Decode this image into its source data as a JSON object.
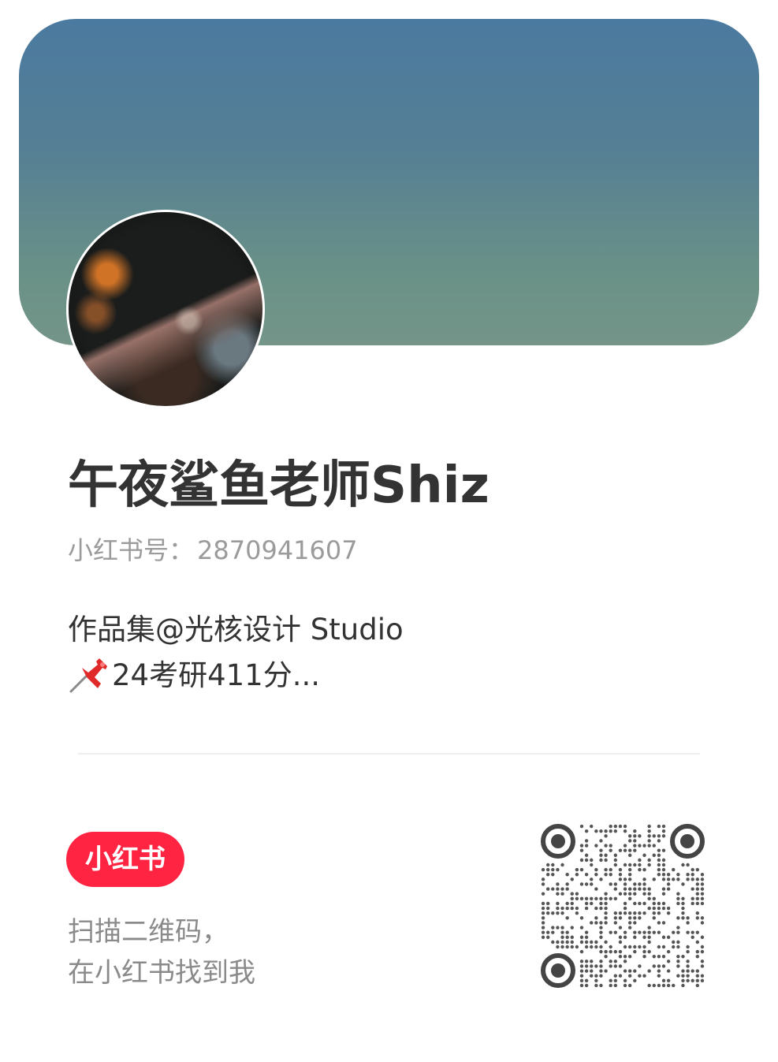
{
  "profile": {
    "name": "午夜鲨鱼老师Shiz",
    "id_label": "小红书号：",
    "id_value": "2870941607",
    "bio_line1": "作品集@光核设计 Studio",
    "bio_line2": "24考研411分..."
  },
  "footer": {
    "brand_logo_text": "小红书",
    "scan_line1": "扫描二维码，",
    "scan_line2": "在小红书找到我"
  },
  "icons": {
    "pin": "pushpin-icon",
    "qr": "qr-code-icon"
  },
  "colors": {
    "brand_red": "#ff2442",
    "cover_top": "#4b7aa0",
    "cover_bottom": "#749588",
    "text_primary": "#333333",
    "text_secondary": "#9b9b9b"
  }
}
